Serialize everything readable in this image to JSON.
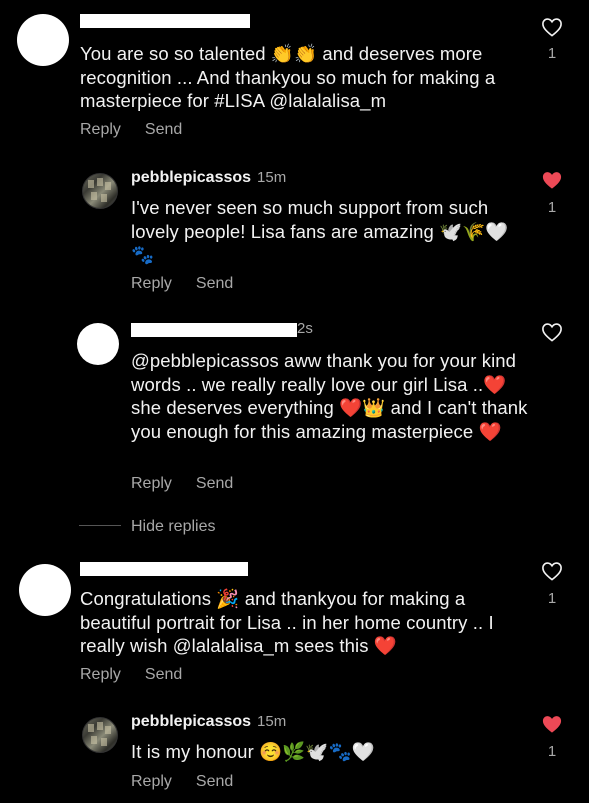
{
  "comments": [
    {
      "text": "You are so so talented 👏👏 and deserves more recognition ... And thankyou so much for making a masterpiece for #LISA @lalalalisa_m",
      "likes": "1",
      "liked": false,
      "reply_label": "Reply",
      "send_label": "Send"
    },
    {
      "username": "pebblepicassos",
      "time": "15m",
      "text": "I've never seen so much support from such lovely people! Lisa fans are amazing 🕊️🌾🤍 🐾",
      "likes": "1",
      "liked": true,
      "reply_label": "Reply",
      "send_label": "Send"
    },
    {
      "time_suffix": "2s",
      "text": "@pebblepicassos aww thank you for your kind words .. we really really love our girl Lisa ..❤️ she deserves everything ❤️👑 and I can't thank you enough for this amazing masterpiece ❤️",
      "liked": false,
      "reply_label": "Reply",
      "send_label": "Send"
    },
    {
      "text": "Congratulations 🎉 and thankyou for making a beautiful portrait for Lisa .. in her home country .. I really wish @lalalalisa_m sees this ❤️",
      "likes": "1",
      "liked": false,
      "reply_label": "Reply",
      "send_label": "Send"
    },
    {
      "username": "pebblepicassos",
      "time": "15m",
      "text": "It is my honour ☺️🌿🕊️🐾🤍",
      "likes": "1",
      "liked": true,
      "reply_label": "Reply",
      "send_label": "Send"
    }
  ],
  "hide_replies_label": "Hide replies",
  "colors": {
    "liked_heart": "#ed4956",
    "muted": "#a8a8a8",
    "background": "#000000"
  }
}
